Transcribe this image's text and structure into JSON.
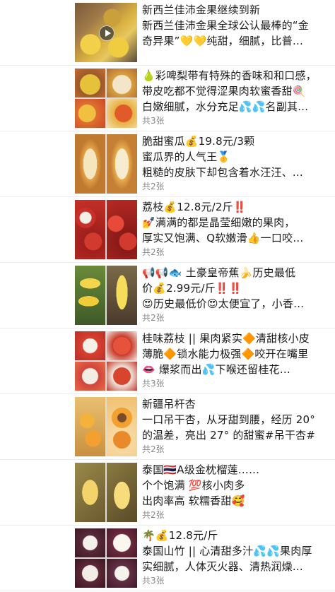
{
  "colors": {
    "text": "#1a1a1a",
    "count": "#8a8a8a",
    "accent": "#d81e06",
    "divider": "#ececec"
  },
  "items": [
    {
      "lines": [
        "新西兰佳沛金果继续到新",
        "新西兰佳沛金果全球公认最棒的“金",
        "奇异果”💛💛纯甜，细腻，比普…"
      ],
      "count": "",
      "has_video": true
    },
    {
      "lines": [
        "🍐彩啤梨带有特殊的香味和和口感，",
        "带皮吃都不觉得涩果肉软蜜香甜🍭",
        "白嫩细腻，水分充足💦💦名副其…"
      ],
      "count": "共3张"
    },
    {
      "lines": [
        "脆甜蜜瓜💰19.8元/3颗",
        "蜜瓜界的人气王🥇",
        "粗糙的皮肤下却包含着水汪汪、…"
      ],
      "count": "共2张"
    },
    {
      "lines": [
        "荔枝💰12.8元/2斤‼️",
        "💅满满的都是晶莹细嫩的果肉，",
        "厚实又饱满、Q软嫩滑👍一口咬…"
      ],
      "count": "共2张"
    },
    {
      "lines": [
        "📢📢🐟 土豪皇帝蕉🍌历史最低",
        "价💰2.99元/斤‼️‼️",
        "😍历史最低价😍太便宜了，小香…"
      ],
      "count": "共2张"
    },
    {
      "lines": [
        "桂味荔枝 || 果肉紧实🔶清甜核小皮",
        "薄脆🔶锁水能力极强🔶咬开在嘴里",
        "👄 爆浆而出💦下喉还留桂花…"
      ],
      "count": "共3张"
    },
    {
      "lines": [
        "新疆吊杆杏",
        "一口吊干杏，从牙甜到腰，经历 20°",
        "的温差，亮出 27° 的甜蜜#吊干杏#"
      ],
      "count": "共2张"
    },
    {
      "lines": [
        "泰国🇹🇭A级金枕榴莲……",
        "个个饱满 💯核小肉多",
        "出肉率高 软糯香甜🥰"
      ],
      "count": "共2张"
    },
    {
      "lines": [
        "🌴💰12.8元/斤",
        "泰国山竹 || 心清甜多汁💦💦果肉厚",
        "实细腻，人体灭火器、清热润燥…"
      ],
      "count": "共3张"
    }
  ]
}
